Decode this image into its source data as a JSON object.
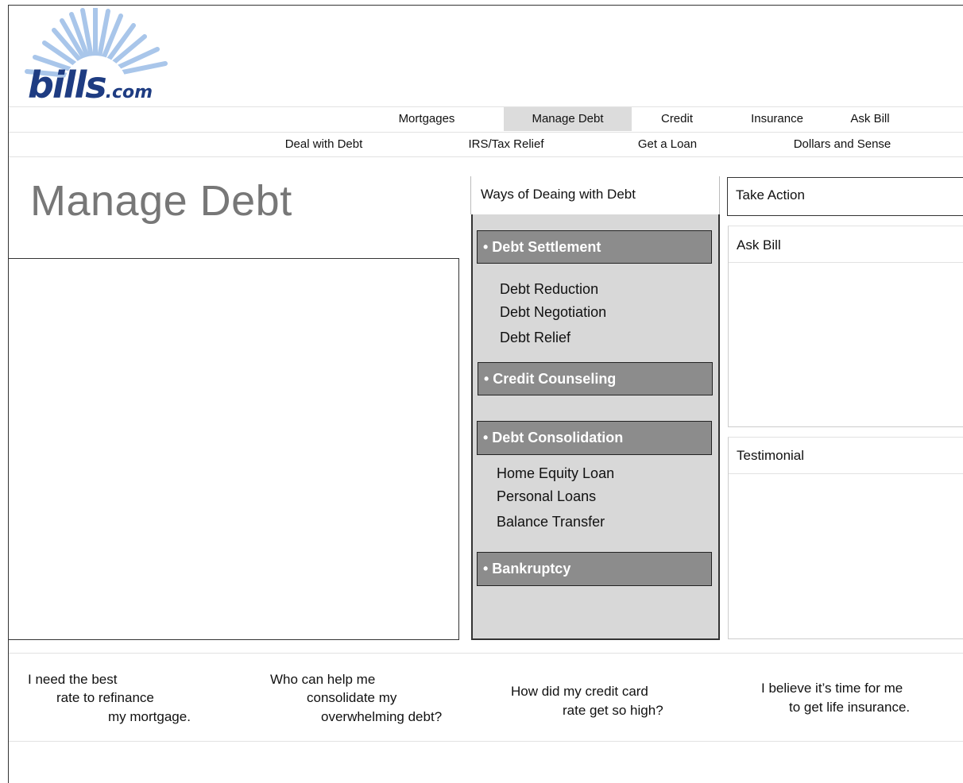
{
  "logo": {
    "word": "bills",
    "tld": ".com"
  },
  "nav": {
    "primary": [
      "Mortgages",
      "Manage Debt",
      "Credit",
      "Insurance",
      "Ask Bill"
    ],
    "secondary": [
      "Deal with Debt",
      "IRS/Tax Relief",
      "Get a Loan",
      "Dollars and Sense"
    ],
    "active": "Manage Debt"
  },
  "page_title": "Manage Debt",
  "ways": {
    "header": "Ways of Deaing with Debt",
    "categories": [
      {
        "label": "• Debt Settlement",
        "links": [
          "Debt Reduction",
          "Debt Negotiation",
          "Debt Relief"
        ]
      },
      {
        "label": "• Credit Counseling",
        "links": []
      },
      {
        "label": "• Debt Consolidation",
        "links": [
          "Home Equity Loan",
          "Personal Loans",
          "Balance Transfer"
        ]
      },
      {
        "label": "• Bankruptcy",
        "links": []
      }
    ]
  },
  "right": {
    "take_action": "Take Action",
    "ask_bill": "Ask Bill",
    "testimonial": "Testimonial"
  },
  "questions": [
    [
      "I need the best",
      "rate to refinance",
      "my mortgage."
    ],
    [
      "Who can help me",
      "consolidate my",
      "overwhelming debt?"
    ],
    [
      "How did my credit card",
      "rate get so high?"
    ],
    [
      "I believe it’s time for me",
      "to get life insurance."
    ]
  ],
  "colors": {
    "logo_blue": "#1e3c82",
    "sunburst": "#8db3e2",
    "category_bar": "#8c8c8c",
    "panel_bg": "#d8d8d8",
    "active_tab": "#dcdcdc"
  }
}
